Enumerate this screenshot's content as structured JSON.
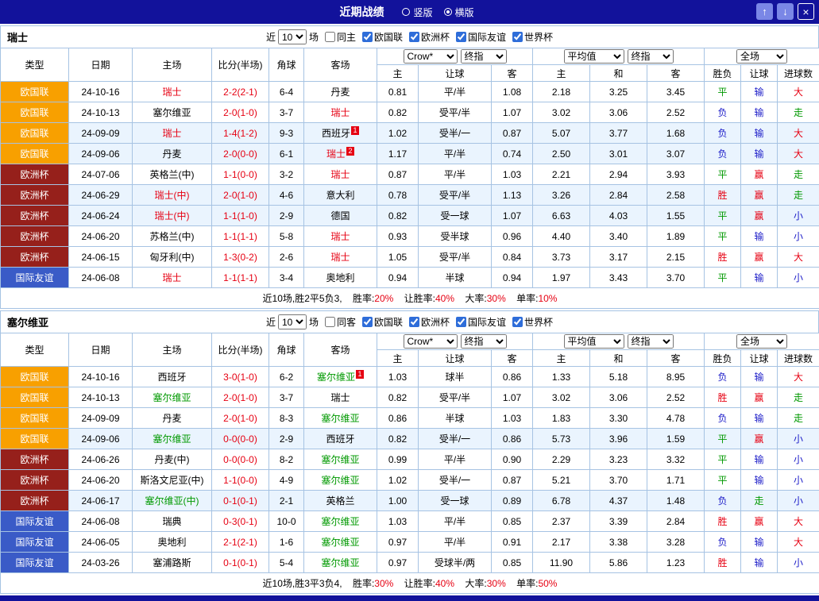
{
  "colors": {
    "navy": "#12129B",
    "btn": "#7A87E6",
    "grid": "#A6C3E3",
    "hl": "#EAF4FE",
    "red": "#E60012",
    "green": "#009900",
    "blue": "#1C1CC8",
    "black": "#000000",
    "score": "#E60012",
    "type_orange": "#F8A000",
    "type_maroon": "#96201B",
    "type_blue": "#3A5BC7"
  },
  "titlebar": {
    "title": "近期战绩",
    "radios": [
      {
        "label": "竖版",
        "selected": false
      },
      {
        "label": "横版",
        "selected": true
      }
    ],
    "buttons": {
      "up": "↑",
      "down": "↓",
      "close": "×"
    }
  },
  "sections": [
    {
      "team": "瑞士",
      "filter": {
        "near": "近",
        "count": "10",
        "unit": "场",
        "same": {
          "label": "同主",
          "checked": false
        },
        "comps": [
          {
            "label": "欧国联",
            "checked": true
          },
          {
            "label": "欧洲杯",
            "checked": true
          },
          {
            "label": "国际友谊",
            "checked": true
          },
          {
            "label": "世界杯",
            "checked": true
          }
        ]
      },
      "table": {
        "cols": [
          "类型",
          "日期",
          "主场",
          "比分(半场)",
          "角球",
          "客场"
        ],
        "g1_sel1": "Crow*",
        "g1_sel2": "终指",
        "g1_cols": [
          "主",
          "让球",
          "客"
        ],
        "g2_sel1": "平均值",
        "g2_sel2": "终指",
        "g2_cols": [
          "主",
          "和",
          "客"
        ],
        "g3_sel": "全场",
        "g3_cols": [
          "胜负",
          "让球",
          "进球数"
        ]
      },
      "rows": [
        {
          "type": "欧国联",
          "tc": "type_orange",
          "date": "24-10-16",
          "home": {
            "n": "瑞士",
            "c": "red"
          },
          "score": "2-2(2-1)",
          "corner": "6-4",
          "away": {
            "n": "丹麦",
            "c": "black"
          },
          "o": [
            "0.81",
            "平/半",
            "1.08"
          ],
          "a": [
            "2.18",
            "3.25",
            "3.45"
          ],
          "r": [
            [
              "平",
              "green"
            ],
            [
              "输",
              "blue"
            ],
            [
              "大",
              "red"
            ]
          ],
          "hl": false
        },
        {
          "type": "欧国联",
          "tc": "type_orange",
          "date": "24-10-13",
          "home": {
            "n": "塞尔维亚",
            "c": "black"
          },
          "score": "2-0(1-0)",
          "corner": "3-7",
          "away": {
            "n": "瑞士",
            "c": "red"
          },
          "o": [
            "0.82",
            "受平/半",
            "1.07"
          ],
          "a": [
            "3.02",
            "3.06",
            "2.52"
          ],
          "r": [
            [
              "负",
              "blue"
            ],
            [
              "输",
              "blue"
            ],
            [
              "走",
              "green"
            ]
          ],
          "hl": false
        },
        {
          "type": "欧国联",
          "tc": "type_orange",
          "date": "24-09-09",
          "home": {
            "n": "瑞士",
            "c": "red"
          },
          "score": "1-4(1-2)",
          "corner": "9-3",
          "away": {
            "n": "西班牙",
            "c": "black",
            "b": "1"
          },
          "o": [
            "1.02",
            "受半/一",
            "0.87"
          ],
          "a": [
            "5.07",
            "3.77",
            "1.68"
          ],
          "r": [
            [
              "负",
              "blue"
            ],
            [
              "输",
              "blue"
            ],
            [
              "大",
              "red"
            ]
          ],
          "hl": true
        },
        {
          "type": "欧国联",
          "tc": "type_orange",
          "date": "24-09-06",
          "home": {
            "n": "丹麦",
            "c": "black"
          },
          "score": "2-0(0-0)",
          "corner": "6-1",
          "away": {
            "n": "瑞士",
            "c": "red",
            "b": "2"
          },
          "o": [
            "1.17",
            "平/半",
            "0.74"
          ],
          "a": [
            "2.50",
            "3.01",
            "3.07"
          ],
          "r": [
            [
              "负",
              "blue"
            ],
            [
              "输",
              "blue"
            ],
            [
              "大",
              "red"
            ]
          ],
          "hl": true
        },
        {
          "type": "欧洲杯",
          "tc": "type_maroon",
          "date": "24-07-06",
          "home": {
            "n": "英格兰(中)",
            "c": "black"
          },
          "score": "1-1(0-0)",
          "corner": "3-2",
          "away": {
            "n": "瑞士",
            "c": "red"
          },
          "o": [
            "0.87",
            "平/半",
            "1.03"
          ],
          "a": [
            "2.21",
            "2.94",
            "3.93"
          ],
          "r": [
            [
              "平",
              "green"
            ],
            [
              "赢",
              "red"
            ],
            [
              "走",
              "green"
            ]
          ],
          "hl": false
        },
        {
          "type": "欧洲杯",
          "tc": "type_maroon",
          "date": "24-06-29",
          "home": {
            "n": "瑞士(中)",
            "c": "red"
          },
          "score": "2-0(1-0)",
          "corner": "4-6",
          "away": {
            "n": "意大利",
            "c": "black"
          },
          "o": [
            "0.78",
            "受平/半",
            "1.13"
          ],
          "a": [
            "3.26",
            "2.84",
            "2.58"
          ],
          "r": [
            [
              "胜",
              "red"
            ],
            [
              "赢",
              "red"
            ],
            [
              "走",
              "green"
            ]
          ],
          "hl": true
        },
        {
          "type": "欧洲杯",
          "tc": "type_maroon",
          "date": "24-06-24",
          "home": {
            "n": "瑞士(中)",
            "c": "red"
          },
          "score": "1-1(1-0)",
          "corner": "2-9",
          "away": {
            "n": "德国",
            "c": "black"
          },
          "o": [
            "0.82",
            "受一球",
            "1.07"
          ],
          "a": [
            "6.63",
            "4.03",
            "1.55"
          ],
          "r": [
            [
              "平",
              "green"
            ],
            [
              "赢",
              "red"
            ],
            [
              "小",
              "blue"
            ]
          ],
          "hl": true
        },
        {
          "type": "欧洲杯",
          "tc": "type_maroon",
          "date": "24-06-20",
          "home": {
            "n": "苏格兰(中)",
            "c": "black"
          },
          "score": "1-1(1-1)",
          "corner": "5-8",
          "away": {
            "n": "瑞士",
            "c": "red"
          },
          "o": [
            "0.93",
            "受半球",
            "0.96"
          ],
          "a": [
            "4.40",
            "3.40",
            "1.89"
          ],
          "r": [
            [
              "平",
              "green"
            ],
            [
              "输",
              "blue"
            ],
            [
              "小",
              "blue"
            ]
          ],
          "hl": false
        },
        {
          "type": "欧洲杯",
          "tc": "type_maroon",
          "date": "24-06-15",
          "home": {
            "n": "匈牙利(中)",
            "c": "black"
          },
          "score": "1-3(0-2)",
          "corner": "2-6",
          "away": {
            "n": "瑞士",
            "c": "red"
          },
          "o": [
            "1.05",
            "受平/半",
            "0.84"
          ],
          "a": [
            "3.73",
            "3.17",
            "2.15"
          ],
          "r": [
            [
              "胜",
              "red"
            ],
            [
              "赢",
              "red"
            ],
            [
              "大",
              "red"
            ]
          ],
          "hl": false
        },
        {
          "type": "国际友谊",
          "tc": "type_blue",
          "date": "24-06-08",
          "home": {
            "n": "瑞士",
            "c": "red"
          },
          "score": "1-1(1-1)",
          "corner": "3-4",
          "away": {
            "n": "奥地利",
            "c": "black"
          },
          "o": [
            "0.94",
            "半球",
            "0.94"
          ],
          "a": [
            "1.97",
            "3.43",
            "3.70"
          ],
          "r": [
            [
              "平",
              "green"
            ],
            [
              "输",
              "blue"
            ],
            [
              "小",
              "blue"
            ]
          ],
          "hl": false
        }
      ],
      "summary": {
        "prefix": "近10场,胜2平5负3,",
        "stats": [
          {
            "label": "胜率:",
            "value": "20%"
          },
          {
            "label": "让胜率:",
            "value": "40%"
          },
          {
            "label": "大率:",
            "value": "30%"
          },
          {
            "label": "单率:",
            "value": "10%"
          }
        ]
      }
    },
    {
      "team": "塞尔维亚",
      "filter": {
        "near": "近",
        "count": "10",
        "unit": "场",
        "same": {
          "label": "同客",
          "checked": false
        },
        "comps": [
          {
            "label": "欧国联",
            "checked": true
          },
          {
            "label": "欧洲杯",
            "checked": true
          },
          {
            "label": "国际友谊",
            "checked": true
          },
          {
            "label": "世界杯",
            "checked": true
          }
        ]
      },
      "table": {
        "cols": [
          "类型",
          "日期",
          "主场",
          "比分(半场)",
          "角球",
          "客场"
        ],
        "g1_sel1": "Crow*",
        "g1_sel2": "终指",
        "g1_cols": [
          "主",
          "让球",
          "客"
        ],
        "g2_sel1": "平均值",
        "g2_sel2": "终指",
        "g2_cols": [
          "主",
          "和",
          "客"
        ],
        "g3_sel": "全场",
        "g3_cols": [
          "胜负",
          "让球",
          "进球数"
        ]
      },
      "rows": [
        {
          "type": "欧国联",
          "tc": "type_orange",
          "date": "24-10-16",
          "home": {
            "n": "西班牙",
            "c": "black"
          },
          "score": "3-0(1-0)",
          "corner": "6-2",
          "away": {
            "n": "塞尔维亚",
            "c": "green",
            "b": "1"
          },
          "o": [
            "1.03",
            "球半",
            "0.86"
          ],
          "a": [
            "1.33",
            "5.18",
            "8.95"
          ],
          "r": [
            [
              "负",
              "blue"
            ],
            [
              "输",
              "blue"
            ],
            [
              "大",
              "red"
            ]
          ],
          "hl": false
        },
        {
          "type": "欧国联",
          "tc": "type_orange",
          "date": "24-10-13",
          "home": {
            "n": "塞尔维亚",
            "c": "green"
          },
          "score": "2-0(1-0)",
          "corner": "3-7",
          "away": {
            "n": "瑞士",
            "c": "black"
          },
          "o": [
            "0.82",
            "受平/半",
            "1.07"
          ],
          "a": [
            "3.02",
            "3.06",
            "2.52"
          ],
          "r": [
            [
              "胜",
              "red"
            ],
            [
              "赢",
              "red"
            ],
            [
              "走",
              "green"
            ]
          ],
          "hl": false
        },
        {
          "type": "欧国联",
          "tc": "type_orange",
          "date": "24-09-09",
          "home": {
            "n": "丹麦",
            "c": "black"
          },
          "score": "2-0(1-0)",
          "corner": "8-3",
          "away": {
            "n": "塞尔维亚",
            "c": "green"
          },
          "o": [
            "0.86",
            "半球",
            "1.03"
          ],
          "a": [
            "1.83",
            "3.30",
            "4.78"
          ],
          "r": [
            [
              "负",
              "blue"
            ],
            [
              "输",
              "blue"
            ],
            [
              "走",
              "green"
            ]
          ],
          "hl": false
        },
        {
          "type": "欧国联",
          "tc": "type_orange",
          "date": "24-09-06",
          "home": {
            "n": "塞尔维亚",
            "c": "green"
          },
          "score": "0-0(0-0)",
          "corner": "2-9",
          "away": {
            "n": "西班牙",
            "c": "black"
          },
          "o": [
            "0.82",
            "受半/一",
            "0.86"
          ],
          "a": [
            "5.73",
            "3.96",
            "1.59"
          ],
          "r": [
            [
              "平",
              "green"
            ],
            [
              "赢",
              "red"
            ],
            [
              "小",
              "blue"
            ]
          ],
          "hl": true
        },
        {
          "type": "欧洲杯",
          "tc": "type_maroon",
          "date": "24-06-26",
          "home": {
            "n": "丹麦(中)",
            "c": "black"
          },
          "score": "0-0(0-0)",
          "corner": "8-2",
          "away": {
            "n": "塞尔维亚",
            "c": "green"
          },
          "o": [
            "0.99",
            "平/半",
            "0.90"
          ],
          "a": [
            "2.29",
            "3.23",
            "3.32"
          ],
          "r": [
            [
              "平",
              "green"
            ],
            [
              "输",
              "blue"
            ],
            [
              "小",
              "blue"
            ]
          ],
          "hl": false
        },
        {
          "type": "欧洲杯",
          "tc": "type_maroon",
          "date": "24-06-20",
          "home": {
            "n": "斯洛文尼亚(中)",
            "c": "black"
          },
          "score": "1-1(0-0)",
          "corner": "4-9",
          "away": {
            "n": "塞尔维亚",
            "c": "green"
          },
          "o": [
            "1.02",
            "受半/一",
            "0.87"
          ],
          "a": [
            "5.21",
            "3.70",
            "1.71"
          ],
          "r": [
            [
              "平",
              "green"
            ],
            [
              "输",
              "blue"
            ],
            [
              "小",
              "blue"
            ]
          ],
          "hl": false
        },
        {
          "type": "欧洲杯",
          "tc": "type_maroon",
          "date": "24-06-17",
          "home": {
            "n": "塞尔维亚(中)",
            "c": "green"
          },
          "score": "0-1(0-1)",
          "corner": "2-1",
          "away": {
            "n": "英格兰",
            "c": "black"
          },
          "o": [
            "1.00",
            "受一球",
            "0.89"
          ],
          "a": [
            "6.78",
            "4.37",
            "1.48"
          ],
          "r": [
            [
              "负",
              "blue"
            ],
            [
              "走",
              "green"
            ],
            [
              "小",
              "blue"
            ]
          ],
          "hl": true
        },
        {
          "type": "国际友谊",
          "tc": "type_blue",
          "date": "24-06-08",
          "home": {
            "n": "瑞典",
            "c": "black"
          },
          "score": "0-3(0-1)",
          "corner": "10-0",
          "away": {
            "n": "塞尔维亚",
            "c": "green"
          },
          "o": [
            "1.03",
            "平/半",
            "0.85"
          ],
          "a": [
            "2.37",
            "3.39",
            "2.84"
          ],
          "r": [
            [
              "胜",
              "red"
            ],
            [
              "赢",
              "red"
            ],
            [
              "大",
              "red"
            ]
          ],
          "hl": false
        },
        {
          "type": "国际友谊",
          "tc": "type_blue",
          "date": "24-06-05",
          "home": {
            "n": "奥地利",
            "c": "black"
          },
          "score": "2-1(2-1)",
          "corner": "1-6",
          "away": {
            "n": "塞尔维亚",
            "c": "green"
          },
          "o": [
            "0.97",
            "平/半",
            "0.91"
          ],
          "a": [
            "2.17",
            "3.38",
            "3.28"
          ],
          "r": [
            [
              "负",
              "blue"
            ],
            [
              "输",
              "blue"
            ],
            [
              "大",
              "red"
            ]
          ],
          "hl": false
        },
        {
          "type": "国际友谊",
          "tc": "type_blue",
          "date": "24-03-26",
          "home": {
            "n": "塞浦路斯",
            "c": "black"
          },
          "score": "0-1(0-1)",
          "corner": "5-4",
          "away": {
            "n": "塞尔维亚",
            "c": "green"
          },
          "o": [
            "0.97",
            "受球半/两",
            "0.85"
          ],
          "a": [
            "11.90",
            "5.86",
            "1.23"
          ],
          "r": [
            [
              "胜",
              "red"
            ],
            [
              "输",
              "blue"
            ],
            [
              "小",
              "blue"
            ]
          ],
          "hl": false
        }
      ],
      "summary": {
        "prefix": "近10场,胜3平3负4,",
        "stats": [
          {
            "label": "胜率:",
            "value": "30%"
          },
          {
            "label": "让胜率:",
            "value": "40%"
          },
          {
            "label": "大率:",
            "value": "30%"
          },
          {
            "label": "单率:",
            "value": "50%"
          }
        ]
      }
    }
  ]
}
